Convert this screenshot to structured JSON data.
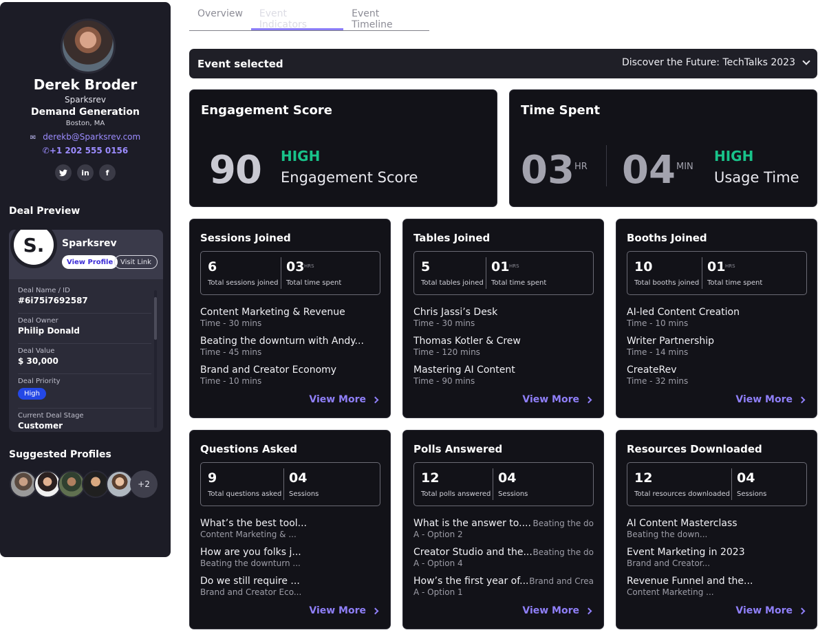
{
  "profile": {
    "name": "Derek Broder",
    "company": "Sparksrev",
    "role": "Demand Generation",
    "location": "Boston, MA",
    "email": "derekb@Sparksrev.com",
    "phone": "+1 202 555 0156",
    "socials": [
      "twitter-icon",
      "linkedin-icon",
      "facebook-icon"
    ]
  },
  "deal_preview": {
    "title": "Deal Preview",
    "logo_text": "S.",
    "company": "Sparksrev",
    "view_profile_label": "View Profile",
    "visit_link_label": "Visit Link",
    "rows": [
      {
        "label": "Deal Name / ID",
        "value": "#6i75i7692587"
      },
      {
        "label": "Deal Owner",
        "value": "Philip Donald"
      },
      {
        "label": "Deal Value",
        "value": "$ 30,000"
      },
      {
        "label": "Deal Priority",
        "value": "High"
      },
      {
        "label": "Current Deal Stage",
        "value": "Customer"
      }
    ]
  },
  "suggested": {
    "title": "Suggested Profiles",
    "more_label": "+2"
  },
  "tabs": [
    {
      "label": "Overview",
      "active": false
    },
    {
      "label": "Event Indicators",
      "active": true
    },
    {
      "label": "Event Timeline",
      "active": false
    }
  ],
  "event_bar": {
    "label": "Event selected",
    "selected_event": "Discover the Future: TechTalks 2023"
  },
  "engagement": {
    "title": "Engagement Score",
    "score": "90",
    "level": "HIGH",
    "sub_label": "Engagement  Score"
  },
  "time_spent": {
    "title": "Time Spent",
    "hours": "03",
    "hours_unit": "HR",
    "minutes": "04",
    "minutes_unit": "MIN",
    "level": "HIGH",
    "sub_label": "Usage Time"
  },
  "view_more_label": "View More",
  "cards": {
    "sessions": {
      "title": "Sessions Joined",
      "stat1": {
        "value": "6",
        "label": "Total sessions joined"
      },
      "stat2": {
        "value": "03",
        "unit": "HRS",
        "label": "Total time spent"
      },
      "items": [
        {
          "title": "Content Marketing & Revenue",
          "sub": "Time - 30 mins"
        },
        {
          "title": "Beating the downturn with Andy...",
          "sub": "Time - 45 mins"
        },
        {
          "title": "Brand and Creator Economy",
          "sub": "Time - 10 mins"
        }
      ]
    },
    "tables": {
      "title": "Tables Joined",
      "stat1": {
        "value": "5",
        "label": "Total tables joined"
      },
      "stat2": {
        "value": "01",
        "unit": "HRS",
        "label": "Total time spent"
      },
      "items": [
        {
          "title": "Chris Jassi’s Desk",
          "sub": "Time - 30 mins"
        },
        {
          "title": "Thomas Kotler & Crew",
          "sub": "Time - 120 mins"
        },
        {
          "title": "Mastering AI Content",
          "sub": "Time - 90 mins"
        }
      ]
    },
    "booths": {
      "title": "Booths Joined",
      "stat1": {
        "value": "10",
        "label": "Total booths joined"
      },
      "stat2": {
        "value": "01",
        "unit": "HRS",
        "label": "Total time spent"
      },
      "items": [
        {
          "title": "AI-led Content Creation",
          "sub": "Time - 10 mins"
        },
        {
          "title": "Writer Partnership",
          "sub": "Time - 14 mins"
        },
        {
          "title": "CreateRev",
          "sub": "Time - 32 mins"
        }
      ]
    },
    "questions": {
      "title": "Questions Asked",
      "stat1": {
        "value": "9",
        "label": "Total questions asked"
      },
      "stat2": {
        "value": "04",
        "label": "Sessions"
      },
      "items": [
        {
          "title": "What’s the best tool...",
          "sub": "Content Marketing & ..."
        },
        {
          "title": "How are you folks j...",
          "sub": "Beating the downturn ..."
        },
        {
          "title": "Do we still require ...",
          "sub": "Brand and Creator Eco..."
        }
      ]
    },
    "polls": {
      "title": "Polls Answered",
      "stat1": {
        "value": "12",
        "label": "Total polls answered"
      },
      "stat2": {
        "value": "04",
        "label": "Sessions"
      },
      "items": [
        {
          "title": "What is the answer to.....",
          "sub": "A - Option 2",
          "right": "Beating the do"
        },
        {
          "title": "Creator Studio and the...",
          "sub": "A - Option 4",
          "right": "Beating the do"
        },
        {
          "title": "How’s the first year of...",
          "sub": "A - Option 1",
          "right": "Brand and Crea"
        }
      ]
    },
    "resources": {
      "title": "Resources Downloaded",
      "stat1": {
        "value": "12",
        "label": "Total resources downloaded"
      },
      "stat2": {
        "value": "04",
        "label": "Sessions"
      },
      "items": [
        {
          "title": "AI Content Masterclass",
          "sub": "Beating the down..."
        },
        {
          "title": "Event Marketing in 2023",
          "sub": "Brand and Creator..."
        },
        {
          "title": "Revenue Funnel and the...",
          "sub": "Content Marketing ..."
        }
      ]
    }
  },
  "colors": {
    "accent": "#8f7ff8",
    "high": "#19c38a",
    "card_bg": "#121218",
    "sidebar_bg": "#1c1c26",
    "priority_badge": "#2448e6"
  }
}
